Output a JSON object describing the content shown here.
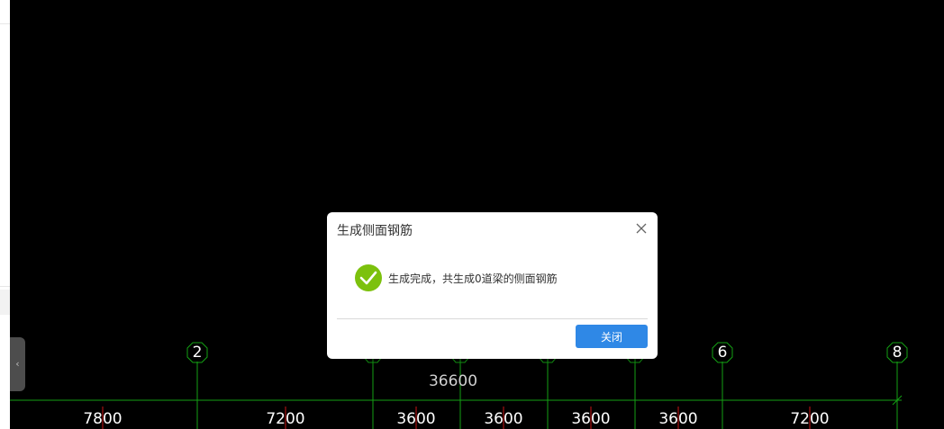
{
  "canvas": {
    "axis_labels": [
      "2",
      "6",
      "8"
    ],
    "total_dimension": "36600",
    "segment_dimensions": [
      "7800",
      "7200",
      "3600",
      "3600",
      "3600",
      "3600",
      "7200"
    ]
  },
  "dialog": {
    "title": "生成侧面钢筋",
    "message": "生成完成，共生成0道梁的侧面钢筋",
    "close_button": "关闭"
  },
  "colors": {
    "axis_green": "#14a014",
    "tick_red": "#c81414",
    "success_green": "#7cc10d",
    "primary_blue": "#2f88e6"
  },
  "icons": {
    "collapse": "chevron-left-icon",
    "success": "checkmark-circle-icon",
    "close": "close-icon"
  }
}
